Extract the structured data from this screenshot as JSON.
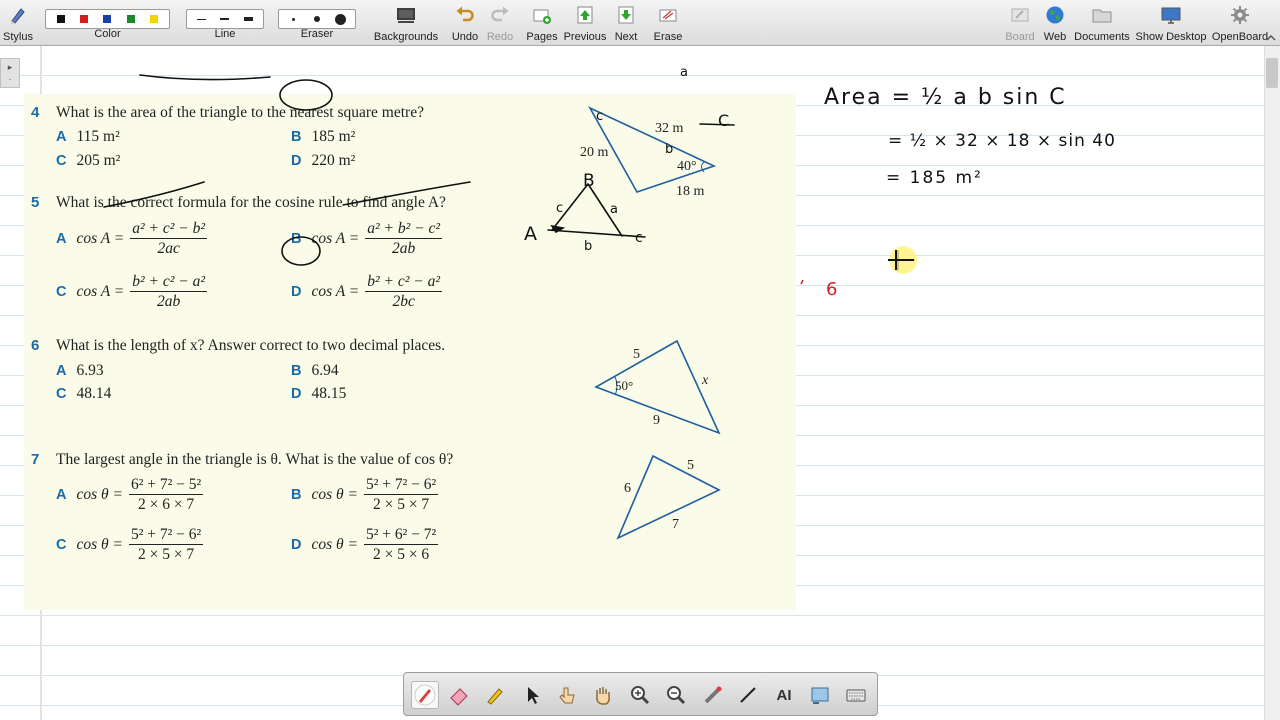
{
  "toolbar": {
    "stylus": "Stylus",
    "color": "Color",
    "line": "Line",
    "eraser": "Eraser",
    "backgrounds": "Backgrounds",
    "undo": "Undo",
    "redo": "Redo",
    "pages": "Pages",
    "previous": "Previous",
    "next": "Next",
    "erase": "Erase",
    "board": "Board",
    "web": "Web",
    "documents": "Documents",
    "show_desktop": "Show Desktop",
    "openboard": "OpenBoard",
    "colors": [
      "#111111",
      "#d81b1b",
      "#1a3fa6",
      "#1c8a2c",
      "#f3d400"
    ]
  },
  "sheet": {
    "q4": {
      "number": "4",
      "text": "What is the area of the triangle to the nearest square metre?",
      "A_letter": "A",
      "A": "115 m²",
      "B_letter": "B",
      "B": "185 m²",
      "C_letter": "C",
      "C": "205 m²",
      "D_letter": "D",
      "D": "220 m²",
      "fig_a": "32 m",
      "fig_b": "20 m",
      "fig_c": "18 m",
      "fig_angle": "40°"
    },
    "q5": {
      "number": "5",
      "text": "What is the correct formula for the cosine rule to find angle A?",
      "A_letter": "A",
      "A_lhs": "cos A =",
      "A_num": "a² + c² − b²",
      "A_den": "2ac",
      "B_letter": "B",
      "B_lhs": "cos A =",
      "B_num": "a² + b² − c²",
      "B_den": "2ab",
      "C_letter": "C",
      "C_lhs": "cos A =",
      "C_num": "b² + c² − a²",
      "C_den": "2ab",
      "D_letter": "D",
      "D_lhs": "cos A =",
      "D_num": "b² + c² − a²",
      "D_den": "2bc"
    },
    "q6": {
      "number": "6",
      "text": "What is the length of x? Answer correct to two decimal places.",
      "A_letter": "A",
      "A": "6.93",
      "B_letter": "B",
      "B": "6.94",
      "C_letter": "C",
      "C": "48.14",
      "D_letter": "D",
      "D": "48.15",
      "fig_5": "5",
      "fig_9": "9",
      "fig_x": "x",
      "fig_angle": "50°"
    },
    "q7": {
      "number": "7",
      "text": "The largest angle in the triangle is θ. What is the value of cos θ?",
      "A_letter": "A",
      "A_lhs": "cos θ =",
      "A_num": "6² + 7² − 5²",
      "A_den": "2 × 6 × 7",
      "B_letter": "B",
      "B_lhs": "cos θ =",
      "B_num": "5² + 7² − 6²",
      "B_den": "2 × 5 × 7",
      "C_letter": "C",
      "C_lhs": "cos θ =",
      "C_num": "5² + 7² − 6²",
      "C_den": "2 × 5 × 7",
      "D_letter": "D",
      "D_lhs": "cos θ =",
      "D_num": "5² + 6² − 7²",
      "D_den": "2 × 5 × 6",
      "fig_5": "5",
      "fig_6": "6",
      "fig_7": "7"
    }
  },
  "handwriting": {
    "line1": "Area = ½ a b sin C",
    "line2": "= ½ × 32 × 18 × sin 40",
    "line3": "= 185 m²",
    "stray_6": "6",
    "q4_label_a": "a",
    "q4_label_b": "b",
    "q4_label_c_side": "c",
    "q4_label_C": "C",
    "tri_B": "B",
    "tri_A": "A",
    "tri_C": "c",
    "tri_a": "a",
    "tri_b": "b",
    "tri_c": "c"
  },
  "colors": {
    "accent_blue": "#1b6aa6",
    "sheet_bg": "#fafbe9",
    "pointer_highlight": "#fff27a",
    "ink_red": "#d11f1f"
  }
}
